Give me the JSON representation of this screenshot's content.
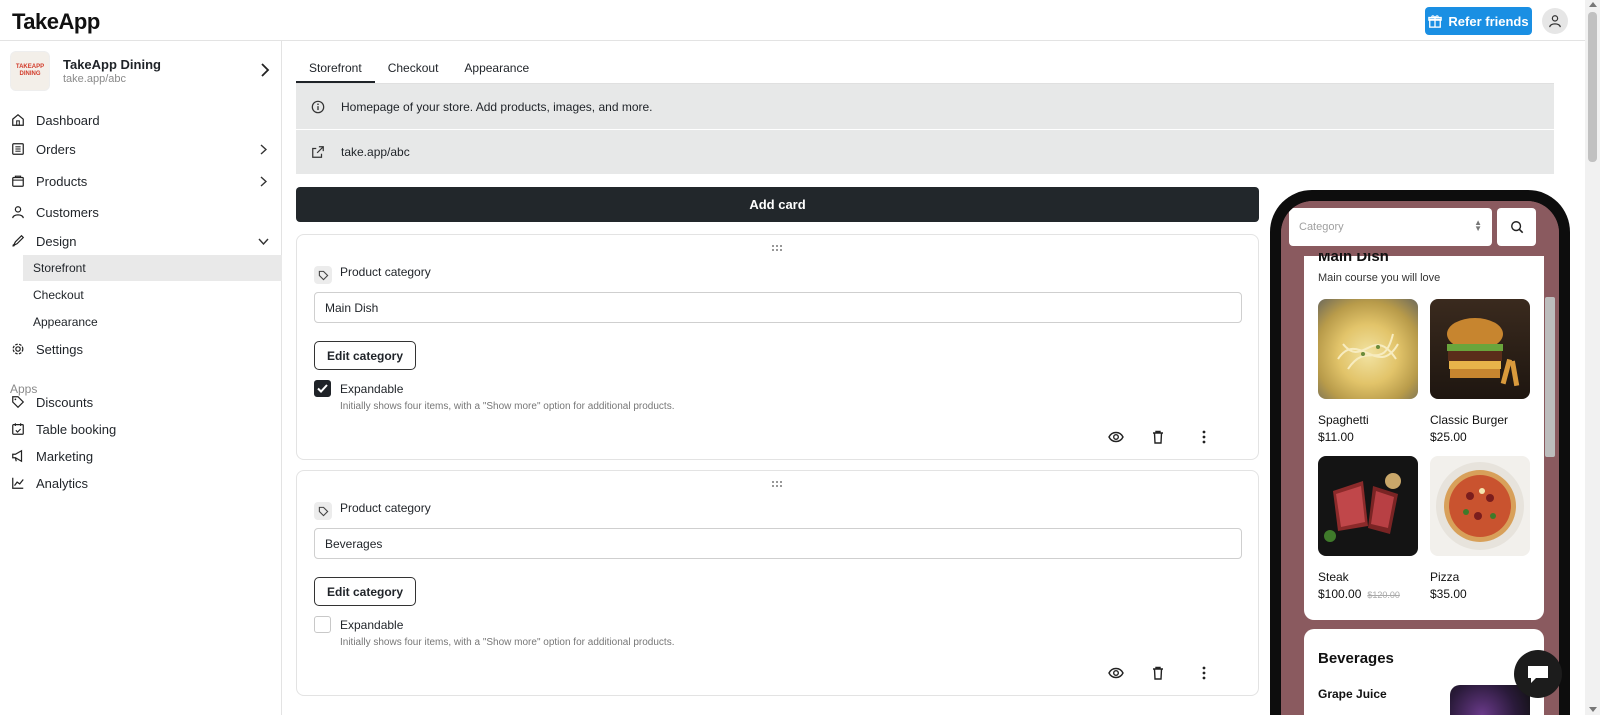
{
  "app": {
    "logo": "TakeApp",
    "refer_label": "Refer friends"
  },
  "store": {
    "name": "TakeApp Dining",
    "url": "take.app/abc",
    "logo_text": "TAKEAPP DINING"
  },
  "sidebar": {
    "items": [
      {
        "label": "Dashboard",
        "icon": "home-icon"
      },
      {
        "label": "Orders",
        "icon": "orders-icon"
      },
      {
        "label": "Products",
        "icon": "products-icon"
      },
      {
        "label": "Customers",
        "icon": "user-icon"
      },
      {
        "label": "Design",
        "icon": "brush-icon"
      }
    ],
    "design_sub": [
      "Storefront",
      "Checkout",
      "Appearance"
    ],
    "settings_label": "Settings",
    "apps_label": "Apps",
    "apps": [
      {
        "label": "Discounts",
        "icon": "tag-icon"
      },
      {
        "label": "Table booking",
        "icon": "calendar-icon"
      },
      {
        "label": "Marketing",
        "icon": "megaphone-icon"
      },
      {
        "label": "Analytics",
        "icon": "chart-icon"
      }
    ]
  },
  "main": {
    "tabs": [
      "Storefront",
      "Checkout",
      "Appearance"
    ],
    "info_text": "Homepage of your store. Add products, images, and more.",
    "link_text": "take.app/abc",
    "add_card_label": "Add card",
    "cards": [
      {
        "type_label": "Product category",
        "value": "Main Dish",
        "edit_label": "Edit category",
        "expandable_label": "Expandable",
        "expandable": true,
        "hint": "Initially shows four items, with a \"Show more\" option for additional products."
      },
      {
        "type_label": "Product category",
        "value": "Beverages",
        "edit_label": "Edit category",
        "expandable_label": "Expandable",
        "expandable": false,
        "hint": "Initially shows four items, with a \"Show more\" option for additional products."
      }
    ]
  },
  "preview": {
    "category_placeholder": "Category",
    "section1": {
      "title": "Main Dish",
      "subtitle": "Main course you will love",
      "products": [
        {
          "name": "Spaghetti",
          "price": "$11.00",
          "old_price": ""
        },
        {
          "name": "Classic Burger",
          "price": "$25.00",
          "old_price": ""
        },
        {
          "name": "Steak",
          "price": "$100.00",
          "old_price": "$120.00"
        },
        {
          "name": "Pizza",
          "price": "$35.00",
          "old_price": ""
        }
      ]
    },
    "section2": {
      "title": "Beverages",
      "first_item": "Grape Juice"
    }
  },
  "colors": {
    "accent": "#1a8fe3",
    "dark": "#22272b",
    "preview_bg": "#8a5a5f"
  }
}
